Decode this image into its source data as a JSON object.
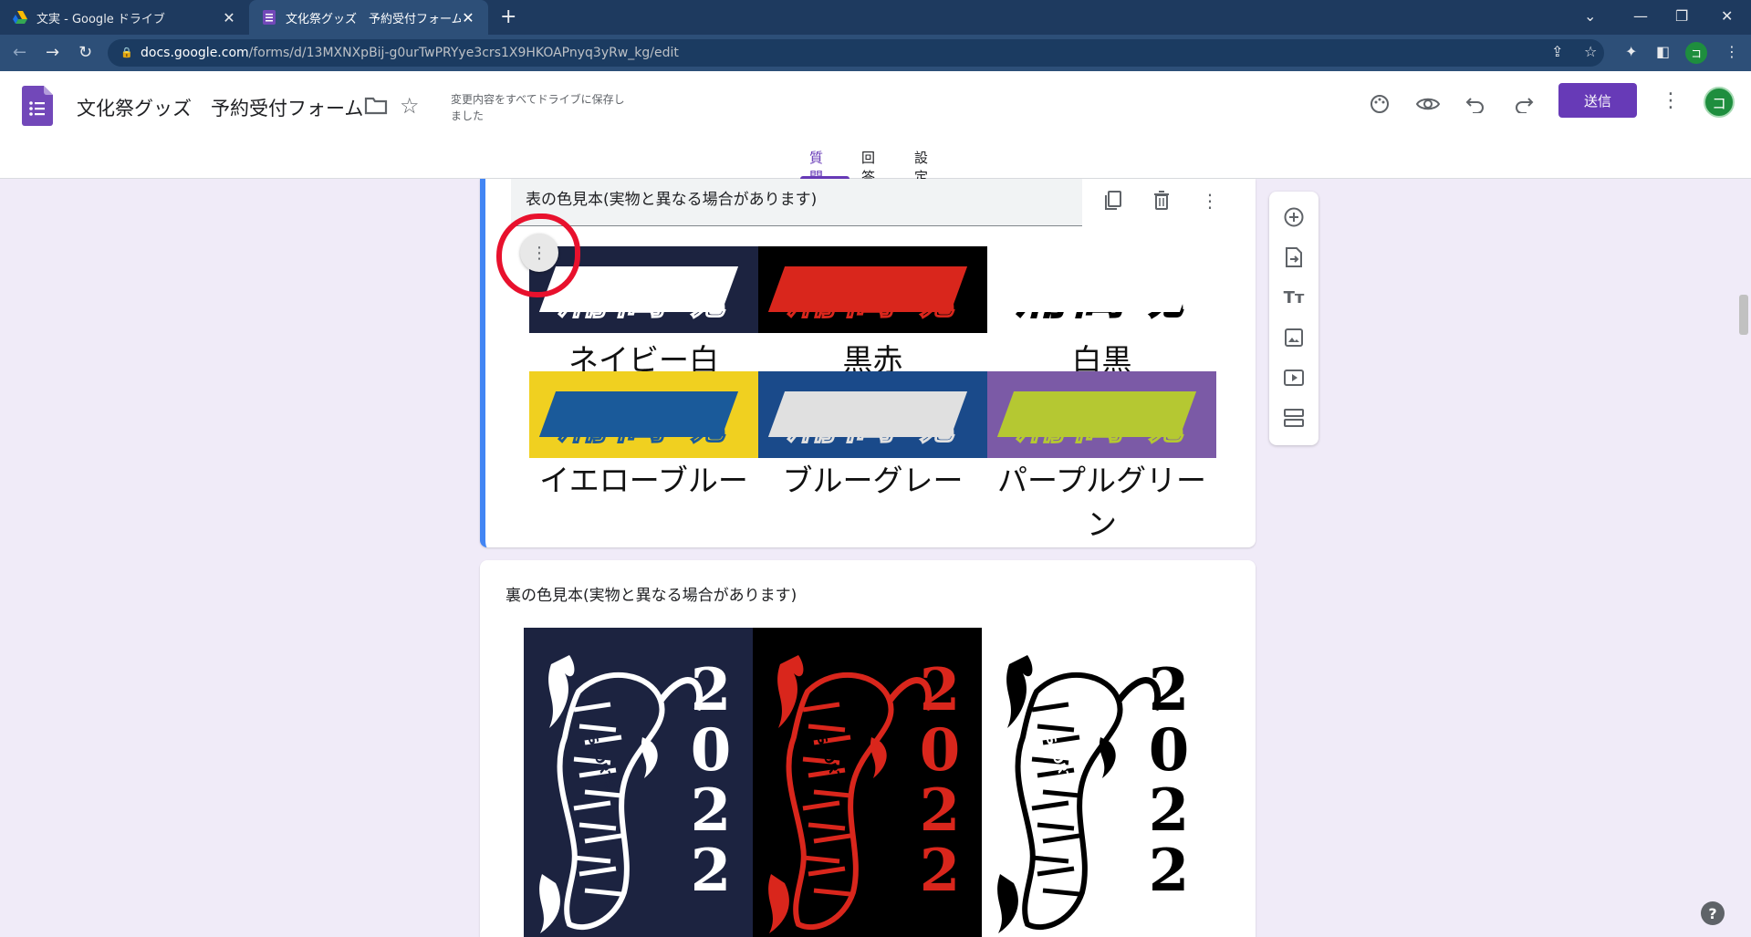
{
  "browser": {
    "tabs": [
      {
        "title": "文実 - Google ドライブ",
        "active": false
      },
      {
        "title": "文化祭グッズ　予約受付フォーム - G",
        "active": true
      }
    ],
    "url_host": "docs.google.com",
    "url_path": "/forms/d/13MXNXpBij-g0urTwPRYye3crs1X9HKOAPnyq3yRw_kg/edit",
    "profile_initial": "コ"
  },
  "header": {
    "doc_title": "文化祭グッズ　予約受付フォーム",
    "save_status": "変更内容をすべてドライブに保存しました",
    "send_label": "送信",
    "avatar_initial": "コ",
    "tabs": [
      {
        "label": "質問",
        "active": true
      },
      {
        "label": "回答",
        "active": false
      },
      {
        "label": "設定",
        "active": false
      }
    ]
  },
  "question1": {
    "title": "表の色見本(実物と異なる場合があります)",
    "swatches": [
      {
        "label": "ネイビー白",
        "bg": "#1c2340",
        "band": "#ffffff",
        "text": "#1c2340"
      },
      {
        "label": "黒赤",
        "bg": "#000000",
        "band": "#d9261c",
        "text": "#000000"
      },
      {
        "label": "白黒",
        "bg": "#ffffff",
        "band": "#000000",
        "text": "#ffffff"
      },
      {
        "label": "イエローブルー",
        "bg": "#f0d020",
        "band": "#1a5a9a",
        "text": "#f0d020"
      },
      {
        "label": "ブルーグレー",
        "bg": "#1a4a8a",
        "band": "#e0e0e0",
        "text": "#1a4a8a"
      },
      {
        "label": "パープルグリーン",
        "bg": "#7b5aa6",
        "band": "#b5c832",
        "text": "#7b5aa6"
      }
    ],
    "logo_text": "浦高魂"
  },
  "question2": {
    "title": "裏の色見本(実物と異なる場合があります)",
    "tigers": [
      {
        "bg": "#1c2340",
        "fg": "#ffffff"
      },
      {
        "bg": "#000000",
        "fg": "#d9261c"
      },
      {
        "bg": "#ffffff",
        "fg": "#000000"
      }
    ],
    "tiger_text": "2022",
    "tiger_side_text": "SPORTS"
  },
  "colors": {
    "accent": "#673ab7",
    "active_border": "#4285f4",
    "annotation_red": "#e8112d"
  }
}
